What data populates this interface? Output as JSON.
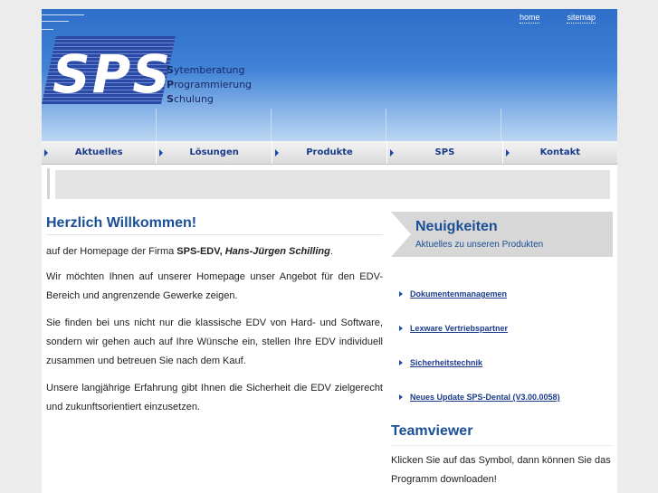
{
  "header": {
    "links": [
      {
        "label": "home"
      },
      {
        "label": "sitemap"
      }
    ],
    "logo": "SPS",
    "tagline": [
      {
        "initial": "S",
        "rest": "ytemberatung"
      },
      {
        "initial": "P",
        "rest": "rogrammierung"
      },
      {
        "initial": "S",
        "rest": "chulung"
      }
    ]
  },
  "nav": {
    "items": [
      {
        "label": "Aktuelles"
      },
      {
        "label": "Lösungen"
      },
      {
        "label": "Produkte"
      },
      {
        "label": "SPS"
      },
      {
        "label": "Kontakt"
      }
    ]
  },
  "main": {
    "title": "Herzlich Willkommen!",
    "intro": {
      "prefix": "auf der Homepage der Firma ",
      "company": "SPS-EDV,",
      "owner": "Hans-Jürgen Schilling",
      "suffix": "."
    },
    "paragraphs": [
      "Wir möchten Ihnen auf unserer Homepage unser Angebot für den EDV-Bereich und angrenzende Gewerke zeigen.",
      "Sie finden bei uns nicht nur die klassische EDV von Hard- und Software, sondern wir gehen auch auf Ihre Wünsche ein, stellen Ihre EDV individuell zusammen und betreuen Sie nach dem Kauf.",
      "Unsere langjährige Erfahrung gibt Ihnen die Sicherheit die EDV zielgerecht und zukunftsorientiert einzusetzen."
    ]
  },
  "sidebar": {
    "news_title": "Neuigkeiten",
    "news_subtitle": "Aktuelles zu unseren Produkten",
    "news_items": [
      {
        "label": "Dokumentenmanagemen"
      },
      {
        "label": "Lexware Vertriebspartner"
      },
      {
        "label": "Sicherheitstechnik"
      },
      {
        "label": "Neues Update SPS-Dental (V3.00.0058)"
      }
    ],
    "teamviewer_title": "Teamviewer",
    "teamviewer_text": "Klicken Sie auf das Symbol, dann können Sie das Programm downloaden!"
  },
  "colors": {
    "accent": "#1a4f96",
    "header_blue": "#3f82d6",
    "nav_text": "#1a3a8a"
  }
}
